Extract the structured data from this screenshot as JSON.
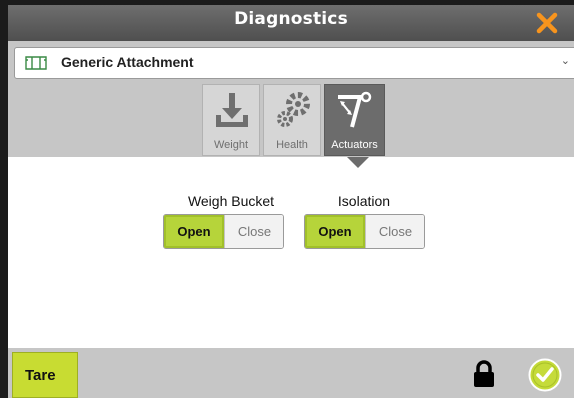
{
  "window": {
    "title": "Diagnostics"
  },
  "header": {
    "close_icon": "close-x-icon",
    "close_color": "#f7941d"
  },
  "dropdown": {
    "value": "Generic Attachment",
    "icon": "attachment-icon"
  },
  "tabs": [
    {
      "label": "Weight",
      "icon": "weight-download-icon",
      "active": false
    },
    {
      "label": "Health",
      "icon": "gears-icon",
      "active": false
    },
    {
      "label": "Actuators",
      "icon": "actuator-arm-icon",
      "active": true
    }
  ],
  "controls": {
    "weigh_bucket": {
      "label": "Weigh Bucket",
      "on": "Open",
      "off": "Close",
      "selected": "Open"
    },
    "isolation": {
      "label": "Isolation",
      "on": "Open",
      "off": "Close",
      "selected": "Open"
    }
  },
  "footer": {
    "tare_label": "Tare",
    "lock_icon": "lock-icon",
    "confirm_icon": "check-circle-icon"
  },
  "colors": {
    "accent": "#b6d43a",
    "tare": "#c8dc32",
    "active_tab": "#6c6c6c",
    "close": "#f7941d"
  }
}
